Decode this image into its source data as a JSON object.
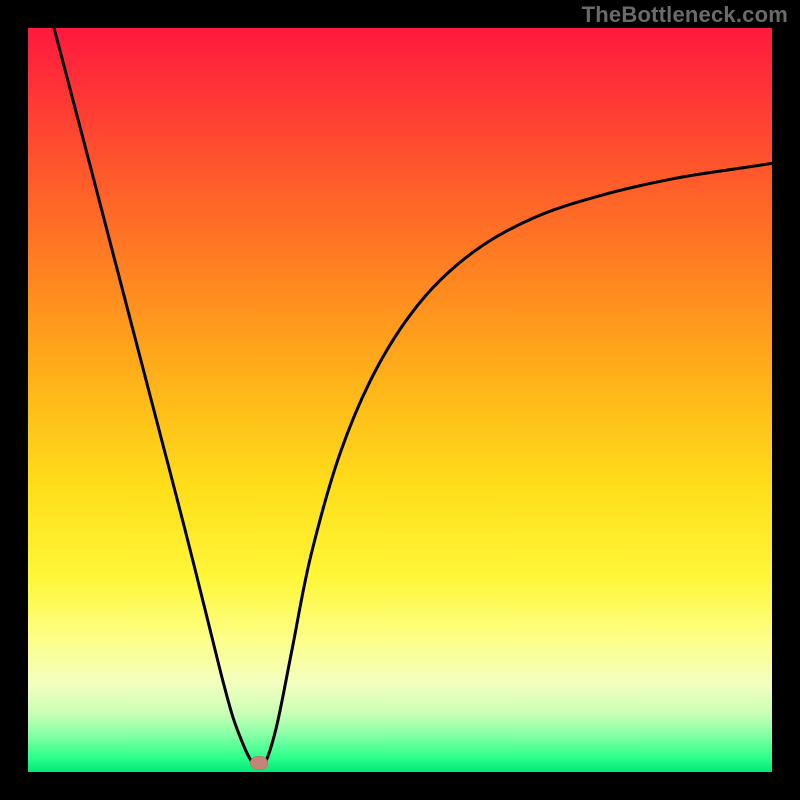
{
  "watermark": "TheBottleneck.com",
  "chart_data": {
    "type": "line",
    "title": "",
    "xlabel": "",
    "ylabel": "",
    "xlim": [
      0,
      1
    ],
    "ylim": [
      0,
      1
    ],
    "grid": false,
    "legend": false,
    "background": {
      "style": "vertical-gradient",
      "stops": [
        {
          "pos": 0.0,
          "color": "#ff193e"
        },
        {
          "pos": 0.33,
          "color": "#ff8320"
        },
        {
          "pos": 0.62,
          "color": "#ffdf1a"
        },
        {
          "pos": 0.88,
          "color": "#f4ffbf"
        },
        {
          "pos": 1.0,
          "color": "#00e877"
        }
      ]
    },
    "series": [
      {
        "name": "bottleneck-curve",
        "color": "#000000",
        "x": [
          0.035,
          0.06,
          0.09,
          0.12,
          0.15,
          0.18,
          0.21,
          0.24,
          0.26,
          0.275,
          0.29,
          0.3,
          0.31,
          0.32,
          0.335,
          0.355,
          0.38,
          0.42,
          0.47,
          0.53,
          0.6,
          0.68,
          0.77,
          0.87,
          0.96,
          1.0
        ],
        "y": [
          1.0,
          0.905,
          0.79,
          0.675,
          0.56,
          0.445,
          0.33,
          0.21,
          0.13,
          0.075,
          0.035,
          0.015,
          0.005,
          0.015,
          0.065,
          0.165,
          0.29,
          0.43,
          0.545,
          0.635,
          0.7,
          0.745,
          0.775,
          0.798,
          0.812,
          0.818
        ]
      }
    ],
    "annotations": [
      {
        "name": "min-marker",
        "shape": "ellipse",
        "color": "#c58477",
        "x": 0.31,
        "y": 0.012
      }
    ]
  }
}
